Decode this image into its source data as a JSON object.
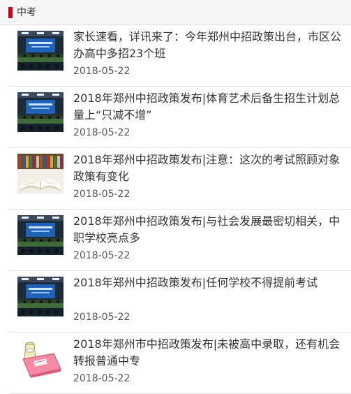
{
  "header": {
    "title": "中考",
    "accent_color": "#d0021b"
  },
  "news": [
    {
      "title": "家长速看，详讯来了：今年郑州中招政策出台，市区公办高中多招23个班",
      "date": "2018-05-22",
      "thumb_icon": "conference-photo-icon"
    },
    {
      "title": "2018年郑州中招政策发布|体育艺术后备生招生计划总量上“只减不增”",
      "date": "2018-05-22",
      "thumb_icon": "conference-photo-icon"
    },
    {
      "title": "2018年郑州中招政策发布|注意：这次的考试照顾对象政策有变化",
      "date": "2018-05-22",
      "thumb_icon": "open-book-photo-icon"
    },
    {
      "title": "2018年郑州中招政策发布|与社会发展最密切相关，中职学校亮点多",
      "date": "2018-05-22",
      "thumb_icon": "conference-photo-icon"
    },
    {
      "title": "2018年郑州中招政策发布|任何学校不得提前考试",
      "date": "2018-05-22",
      "thumb_icon": "conference-photo-icon"
    },
    {
      "title": "2018年郑州市中招政策发布|未被高中录取，还有机会转报普通中专",
      "date": "2018-05-22",
      "thumb_icon": "pink-book-icon"
    }
  ]
}
